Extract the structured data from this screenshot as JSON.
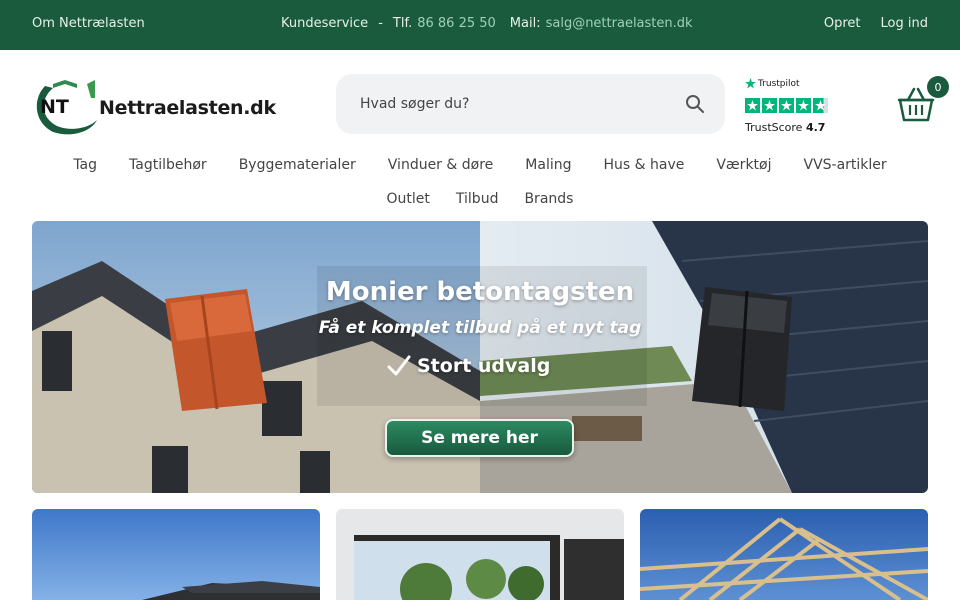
{
  "topbar": {
    "about": "Om Nettrælasten",
    "customer_service": "Kundeservice",
    "separator": "-",
    "phone_label": "Tlf.",
    "phone_number": "86 86 25 50",
    "mail_label": "Mail:",
    "mail_address": "salg@nettraelasten.dk",
    "create": "Opret",
    "login": "Log ind"
  },
  "logo": {
    "mark": "NT",
    "text": "Nettraelasten.dk"
  },
  "search": {
    "placeholder": "Hvad søger du?",
    "icon": "search-icon"
  },
  "trustpilot": {
    "brand": "Trustpilot",
    "score_label": "TrustScore",
    "score": "4.7",
    "stars": 4.7
  },
  "cart": {
    "icon": "basket-icon",
    "count": "0"
  },
  "nav": {
    "row1": [
      "Tag",
      "Tagtilbehør",
      "Byggematerialer",
      "Vinduer & døre",
      "Maling",
      "Hus & have",
      "Værktøj",
      "VVS-artikler"
    ],
    "row2": [
      "Outlet",
      "Tilbud",
      "Brands"
    ]
  },
  "banner": {
    "title": "Monier betontagsten",
    "subtitle": "Få et komplet tilbud på et nyt tag",
    "check_text": "Stort udvalg",
    "cta": "Se mere her"
  },
  "colors": {
    "topbar": "#1a5b3e",
    "accent": "#1a5b3e",
    "trustpilot_green": "#00b67a",
    "search_bg": "#f1f2f4"
  }
}
